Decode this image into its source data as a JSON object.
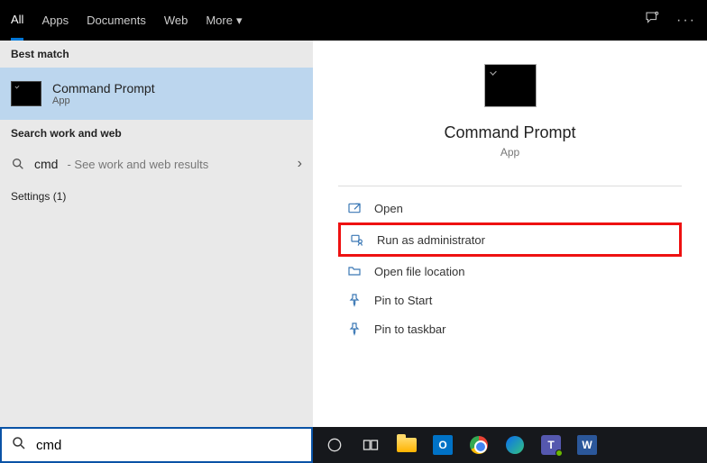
{
  "topbar": {
    "tabs": [
      "All",
      "Apps",
      "Documents",
      "Web",
      "More"
    ],
    "active_index": 0
  },
  "left": {
    "best_match_heading": "Best match",
    "best_match_title": "Command Prompt",
    "best_match_sub": "App",
    "work_web_heading": "Search work and web",
    "query": "cmd",
    "web_hint": " - See work and web results",
    "settings_heading": "Settings (1)"
  },
  "preview": {
    "title": "Command Prompt",
    "sub": "App"
  },
  "actions": [
    {
      "id": "open",
      "label": "Open",
      "highlight": false
    },
    {
      "id": "runadmin",
      "label": "Run as administrator",
      "highlight": true
    },
    {
      "id": "openloc",
      "label": "Open file location",
      "highlight": false
    },
    {
      "id": "pinstart",
      "label": "Pin to Start",
      "highlight": false
    },
    {
      "id": "pintaskbar",
      "label": "Pin to taskbar",
      "highlight": false
    }
  ],
  "search": {
    "value": "cmd"
  },
  "taskbar": {
    "icons": [
      "cortana",
      "taskview",
      "explorer",
      "outlook",
      "chrome",
      "edge",
      "teams",
      "word"
    ]
  }
}
